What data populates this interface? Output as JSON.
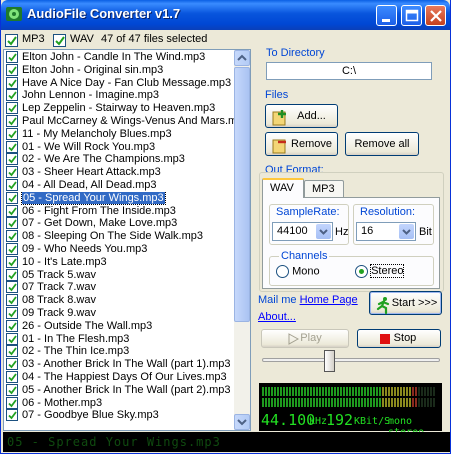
{
  "window": {
    "title": "AudioFile Converter v1.7"
  },
  "filters": {
    "mp3_label": "MP3",
    "wav_label": "WAV",
    "summary": "47 of 47 files selected"
  },
  "files": [
    "Elton John - Candle In The Wind.mp3",
    "Elton John - Original sin.mp3",
    "Have A Nice Day - Fan Club Message.mp3",
    "John Lennon - Imagine.mp3",
    "Lep Zeppelin - Stairway to Heaven.mp3",
    "Paul McCarney & Wings-Venus And Mars.mp",
    "11 - My Melancholy Blues.mp3",
    "01 - We Will Rock You.mp3",
    "02 - We Are The Champions.mp3",
    "03 - Sheer Heart Attack.mp3",
    "04 - All Dead, All Dead.mp3",
    "05 - Spread Your Wings.mp3",
    "06 - Fight From The Inside.mp3",
    "07 - Get Down, Make Love.mp3",
    "08 - Sleeping On The Side Walk.mp3",
    "09 - Who Needs You.mp3",
    "10 - It's Late.mp3",
    "05 Track 5.wav",
    "07 Track 7.wav",
    "08 Track 8.wav",
    "09 Track 9.wav",
    "26 - Outside The Wall.mp3",
    "01 - In The Flesh.mp3",
    "02 - The Thin Ice.mp3",
    "03 - Another Brick In The Wall (part 1).mp3",
    "04 - The Happiest Days Of Our Lives.mp3",
    "05 - Another Brick In The Wall (part 2).mp3",
    "06 - Mother.mp3",
    "07 - Goodbye Blue Sky.mp3"
  ],
  "selected_file": "05 - Spread Your Wings.mp3",
  "directory": {
    "label": "To Directory",
    "value": "C:\\"
  },
  "files_group": {
    "label": "Files",
    "add": "Add...",
    "remove": "Remove",
    "remove_all": "Remove all"
  },
  "out_format": {
    "label": "Out Format:",
    "tabs": [
      "WAV",
      "MP3"
    ],
    "samplerate_label": "SampleRate:",
    "samplerate_value": "44100",
    "samplerate_unit": "Hz",
    "resolution_label": "Resolution:",
    "resolution_value": "16",
    "resolution_unit": "Bit",
    "channels_label": "Channels",
    "mono": "Mono",
    "stereo": "Stereo",
    "selected_channel": "Stereo"
  },
  "links": {
    "mail": "Mail me",
    "home": "Home Page",
    "about": "About..."
  },
  "actions": {
    "start": "Start >>>",
    "play": "Play",
    "stop": "Stop"
  },
  "position": 0.37,
  "display": {
    "freq": "44.100",
    "freq_unit": "kHz",
    "bitrate": "192",
    "bitrate_unit": "KBit/S",
    "mode": "mono stereo"
  },
  "ticker_text": "05 - Spread Your Wings.mp3"
}
